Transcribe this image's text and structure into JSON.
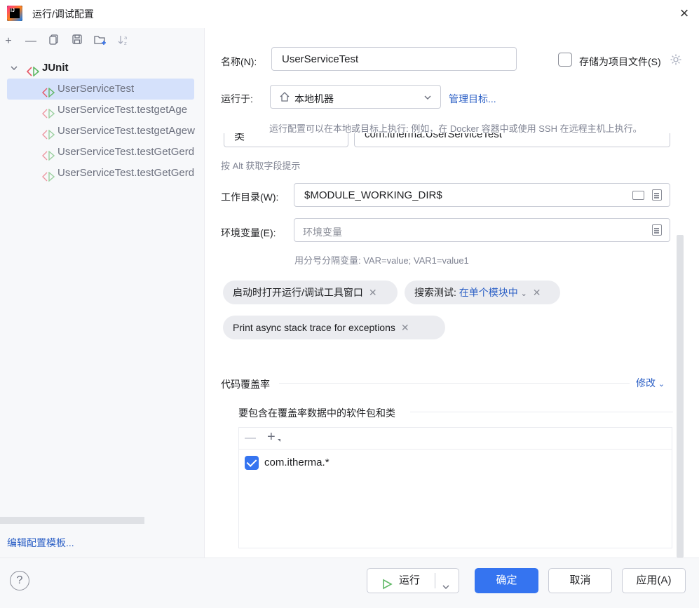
{
  "window": {
    "title": "运行/调试配置",
    "close_icon": "×"
  },
  "toolbar": {
    "add": "+",
    "remove": "—",
    "copy": "⧉",
    "save": "💾",
    "new_folder": "📁",
    "sort": "↓a"
  },
  "tree": {
    "group_label": "JUnit",
    "items": [
      {
        "label": "UserServiceTest"
      },
      {
        "label": "UserServiceTest.testgetAge"
      },
      {
        "label": "UserServiceTest.testgetAgew"
      },
      {
        "label": "UserServiceTest.testGetGerd"
      },
      {
        "label": "UserServiceTest.testGetGerd"
      }
    ]
  },
  "edit_templates_link": "编辑配置模板...",
  "form": {
    "name_label": "名称(N):",
    "name_value": "UserServiceTest",
    "store_label": "存储为项目文件(S)",
    "run_on_label": "运行于:",
    "run_on_value": "本地机器",
    "manage_targets": "管理目标...",
    "run_on_hint": "运行配置可以在本地或目标上执行: 例如，在 Docker 容器中或使用 SSH 在远程主机上执行。",
    "class_kind": "类",
    "class_value": "com.itherma.UserServiceTest",
    "alt_hint": "按 Alt 获取字段提示",
    "workdir_label": "工作目录(W):",
    "workdir_value": "$MODULE_WORKING_DIR$",
    "env_label": "环境变量(E):",
    "env_placeholder": "环境变量",
    "env_hint": "用分号分隔变量: VAR=value; VAR1=value1",
    "chip1": "启动时打开运行/调试工具窗口",
    "chip2_prefix": "搜索测试:",
    "chip2_value": "在单个模块中",
    "chip3": "Print async stack trace for exceptions",
    "coverage_label": "代码覆盖率",
    "modify_link": "修改",
    "include_label": "要包含在覆盖率数据中的软件包和类",
    "coverage_items": [
      {
        "label": "com.itherma.*",
        "checked": true
      }
    ]
  },
  "buttons": {
    "run": "运行",
    "ok": "确定",
    "cancel": "取消",
    "apply": "应用(A)",
    "help": "?"
  },
  "colors": {
    "accent": "#3574f0",
    "link": "#2a5ec5",
    "selection": "#d5e1fb"
  }
}
